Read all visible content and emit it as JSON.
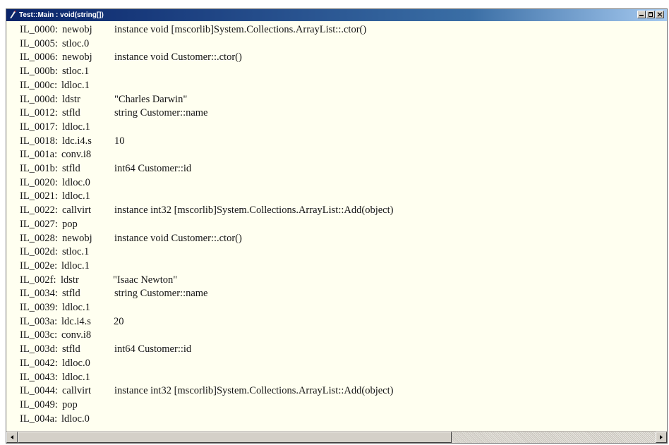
{
  "window": {
    "title": "Test::Main : void(string[])",
    "controls": {
      "minimize_icon": "minimize-icon",
      "maximize_icon": "maximize-icon",
      "close_icon": "close-icon"
    }
  },
  "code": {
    "lines": [
      {
        "label": "IL_0000:",
        "opcode": "newobj",
        "operand": "instance void [mscorlib]System.Collections.ArrayList::.ctor()"
      },
      {
        "label": "IL_0005:",
        "opcode": "stloc.0",
        "operand": ""
      },
      {
        "label": "IL_0006:",
        "opcode": "newobj",
        "operand": "instance void Customer::.ctor()"
      },
      {
        "label": "IL_000b:",
        "opcode": "stloc.1",
        "operand": ""
      },
      {
        "label": "IL_000c:",
        "opcode": "ldloc.1",
        "operand": ""
      },
      {
        "label": "IL_000d:",
        "opcode": "ldstr",
        "operand": "\"Charles Darwin\""
      },
      {
        "label": "IL_0012:",
        "opcode": "stfld",
        "operand": "string Customer::name"
      },
      {
        "label": "IL_0017:",
        "opcode": "ldloc.1",
        "operand": ""
      },
      {
        "label": "IL_0018:",
        "opcode": "ldc.i4.s",
        "operand": "10"
      },
      {
        "label": "IL_001a:",
        "opcode": "conv.i8",
        "operand": ""
      },
      {
        "label": "IL_001b:",
        "opcode": "stfld",
        "operand": "int64 Customer::id"
      },
      {
        "label": "IL_0020:",
        "opcode": "ldloc.0",
        "operand": ""
      },
      {
        "label": "IL_0021:",
        "opcode": "ldloc.1",
        "operand": ""
      },
      {
        "label": "IL_0022:",
        "opcode": "callvirt",
        "operand": "instance int32 [mscorlib]System.Collections.ArrayList::Add(object)"
      },
      {
        "label": "IL_0027:",
        "opcode": "pop",
        "operand": ""
      },
      {
        "label": "IL_0028:",
        "opcode": "newobj",
        "operand": "instance void Customer::.ctor()"
      },
      {
        "label": "IL_002d:",
        "opcode": "stloc.1",
        "operand": ""
      },
      {
        "label": "IL_002e:",
        "opcode": "ldloc.1",
        "operand": ""
      },
      {
        "label": "IL_002f:",
        "opcode": "ldstr",
        "operand": "\"Isaac Newton\""
      },
      {
        "label": "IL_0034:",
        "opcode": "stfld",
        "operand": "string Customer::name"
      },
      {
        "label": "IL_0039:",
        "opcode": "ldloc.1",
        "operand": ""
      },
      {
        "label": "IL_003a:",
        "opcode": "ldc.i4.s",
        "operand": "20"
      },
      {
        "label": "IL_003c:",
        "opcode": "conv.i8",
        "operand": ""
      },
      {
        "label": "IL_003d:",
        "opcode": "stfld",
        "operand": "int64 Customer::id"
      },
      {
        "label": "IL_0042:",
        "opcode": "ldloc.0",
        "operand": ""
      },
      {
        "label": "IL_0043:",
        "opcode": "ldloc.1",
        "operand": ""
      },
      {
        "label": "IL_0044:",
        "opcode": "callvirt",
        "operand": "instance int32 [mscorlib]System.Collections.ArrayList::Add(object)"
      },
      {
        "label": "IL_0049:",
        "opcode": "pop",
        "operand": ""
      },
      {
        "label": "IL_004a:",
        "opcode": "ldloc.0",
        "operand": ""
      }
    ]
  },
  "scrollbar": {
    "left_icon": "scroll-left-icon",
    "right_icon": "scroll-right-icon",
    "position": 0,
    "visible_fraction": 0.68
  },
  "colors": {
    "titlebar_start": "#0a246a",
    "titlebar_end": "#a6caf0",
    "background": "#fffff0",
    "text": "#141414"
  }
}
